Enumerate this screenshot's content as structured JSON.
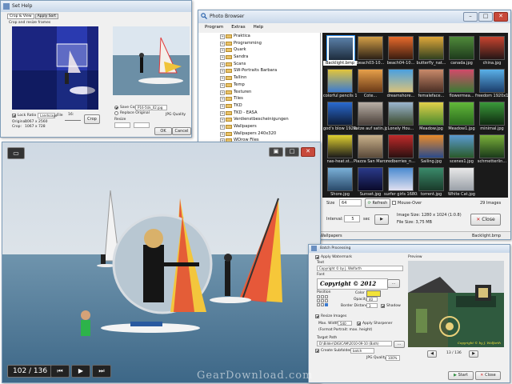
{
  "crop_window": {
    "title": "Set Help",
    "tabs": [
      "Crop & View",
      "Apply Sort"
    ],
    "section": "Crop and resize frames",
    "lock_label": "Lock Ratio",
    "ratio_value": "Landscape",
    "file_label": "File",
    "zoom_label": "16:",
    "original_label": "Original:",
    "original_size": "1067 x 2560",
    "crop_label": "Crop:",
    "crop_size": "1067 x 728",
    "crop_btn": "Crop",
    "save_copy_label": "Save Copy",
    "replace_label": "Replace Original",
    "filename": "P16-5Uk_02.jpg",
    "resize_label": "Resize",
    "jpg_label": "JPG Quality",
    "ok": "OK",
    "cancel": "Cancel"
  },
  "browser": {
    "title": "Photo Browser",
    "menu": [
      "Program",
      "Extras",
      "Help"
    ],
    "tree": [
      "Praktica",
      "Programming",
      "Quark",
      "Sandra",
      "Scans",
      "SW-Portraits Barbara",
      "Tallinn",
      "Temp",
      "Texturen",
      "Tiles",
      "TKD",
      "TKD - EASA",
      "Verdienstbescheinigungen",
      "Wallpapers",
      "Wallpapers 240x320",
      "WDrow Files",
      "XRest-Cliparts",
      "XX"
    ],
    "thumbs": [
      {
        "name": "Backlight.bmp",
        "c1": "#5a7fa8",
        "c2": "#1d2b3c"
      },
      {
        "name": "beach03-10...",
        "c1": "#d4a047",
        "c2": "#2b2016"
      },
      {
        "name": "beach04-10...",
        "c1": "#e86a2c",
        "c2": "#3a1c10"
      },
      {
        "name": "butterfly_nat...",
        "c1": "#e0a83a",
        "c2": "#30401f"
      },
      {
        "name": "canada.jpg",
        "c1": "#4f8a3a",
        "c2": "#1e3a1c"
      },
      {
        "name": "china.jpg",
        "c1": "#c8442f",
        "c2": "#241616"
      },
      {
        "name": "colorful pencils 1920x1440",
        "c1": "#e2c43a",
        "c2": "#3c7bd0"
      },
      {
        "name": "Cote...",
        "c1": "#e7a04a",
        "c2": "#6b3a18"
      },
      {
        "name": "dreamshore...",
        "c1": "#4aa0e0",
        "c2": "#d9c27a"
      },
      {
        "name": "femaleface...",
        "c1": "#c98a6a",
        "c2": "#4a2e24"
      },
      {
        "name": "flowermea...",
        "c1": "#d24a6a",
        "c2": "#3b7a33"
      },
      {
        "name": "freedom 1920x1200.jpg",
        "c1": "#5ab0e8",
        "c2": "#1b3d6b"
      },
      {
        "name": "god's blow 1920x1440.jpg",
        "c1": "#2a6ad0",
        "c2": "#0d1c38"
      },
      {
        "name": "katze auf satin.jpg",
        "c1": "#b9b0a6",
        "c2": "#4a403a"
      },
      {
        "name": "Lonely Hou...",
        "c1": "#9bb6d0",
        "c2": "#3a4a2b"
      },
      {
        "name": "Meadow.jpg",
        "c1": "#e2d04a",
        "c2": "#4a8a2e"
      },
      {
        "name": "Meadow1.jpg",
        "c1": "#62b83a",
        "c2": "#2a6a1e"
      },
      {
        "name": "minimal.jpg",
        "c1": "#3a9a3a",
        "c2": "#0f2a10"
      },
      {
        "name": "nas-heat.st...",
        "c1": "#e0d030",
        "c2": "#1a1a1a"
      },
      {
        "name": "Piazza San Marco 1920",
        "c1": "#c9b08a",
        "c2": "#5a4a3a"
      },
      {
        "name": "redberries_n...",
        "c1": "#c02a2a",
        "c2": "#2a1010"
      },
      {
        "name": "Sailing.jpg",
        "c1": "#e88a2a",
        "c2": "#2a4a8a"
      },
      {
        "name": "scenes1.jpg",
        "c1": "#5a9ad0",
        "c2": "#2a5a2a"
      },
      {
        "name": "schmetterlin...",
        "c1": "#7ab03a",
        "c2": "#1a3a1a"
      },
      {
        "name": "Shore.jpg",
        "c1": "#7ab0d8",
        "c2": "#2a4a6a"
      },
      {
        "name": "Sunset.jpg",
        "c1": "#2a3a8a",
        "c2": "#0a0a2a"
      },
      {
        "name": "surfer girls 1680x1050.jpg",
        "c1": "#4a8ad0",
        "c2": "#e0e0f0"
      },
      {
        "name": "torrent.jpg",
        "c1": "#3a8a6a",
        "c2": "#1a3a2a"
      },
      {
        "name": "White Cat.jpg",
        "c1": "#e8e8e8",
        "c2": "#9aa0a8"
      }
    ],
    "size_label": "Size",
    "size_value": "64",
    "refresh": "Refresh",
    "mouseover": "Mouse-Over",
    "images_count": "29 Images",
    "interval_label": "Interval:",
    "interval_value": "5",
    "sec": "sec",
    "image_size": "Image Size: 1280 x 1024 (1:0.8)",
    "file_size": "File Size: 3,75 MB",
    "close": "Close",
    "status_left": "Wallpapers",
    "status_right": "Backlight.bmp"
  },
  "viewer": {
    "counter": "102 / 136"
  },
  "batch": {
    "title": "Batch Processing",
    "apply_watermark": "Apply Watermark",
    "text_label": "Text",
    "text_value": "Copyright © by J. Wolfarth",
    "font_label": "Font",
    "preview_label": "Preview",
    "copyright": "Copyright © 2012",
    "position_label": "Position",
    "color_label": "Color",
    "opacity_label": "Opacity",
    "opacity_value": "40",
    "border_label": "Border Distance",
    "border_value": "3",
    "shadow_label": "Shadow",
    "resize_images": "Resize Images",
    "max_width": "Max. Width",
    "max_width_value": "540",
    "apply_sharpen": "Apply Sharpener",
    "format_note": "(Format Portrait: max. height)",
    "target_label": "Target Path",
    "target_value": "D:\\Bilder\\DIGICAM\\2010-09-10 (Bath)",
    "create_subfolder": "Create Subfolder",
    "subfolder_value": "batch",
    "jpg_label": "JPG Quality",
    "jpg_value": "100%",
    "preview_counter": "13 / 136",
    "preview_watermark": "Copyright © by J. Wolfarth",
    "start": "Start",
    "close": "Close"
  },
  "watermark": "GearDownload.com"
}
